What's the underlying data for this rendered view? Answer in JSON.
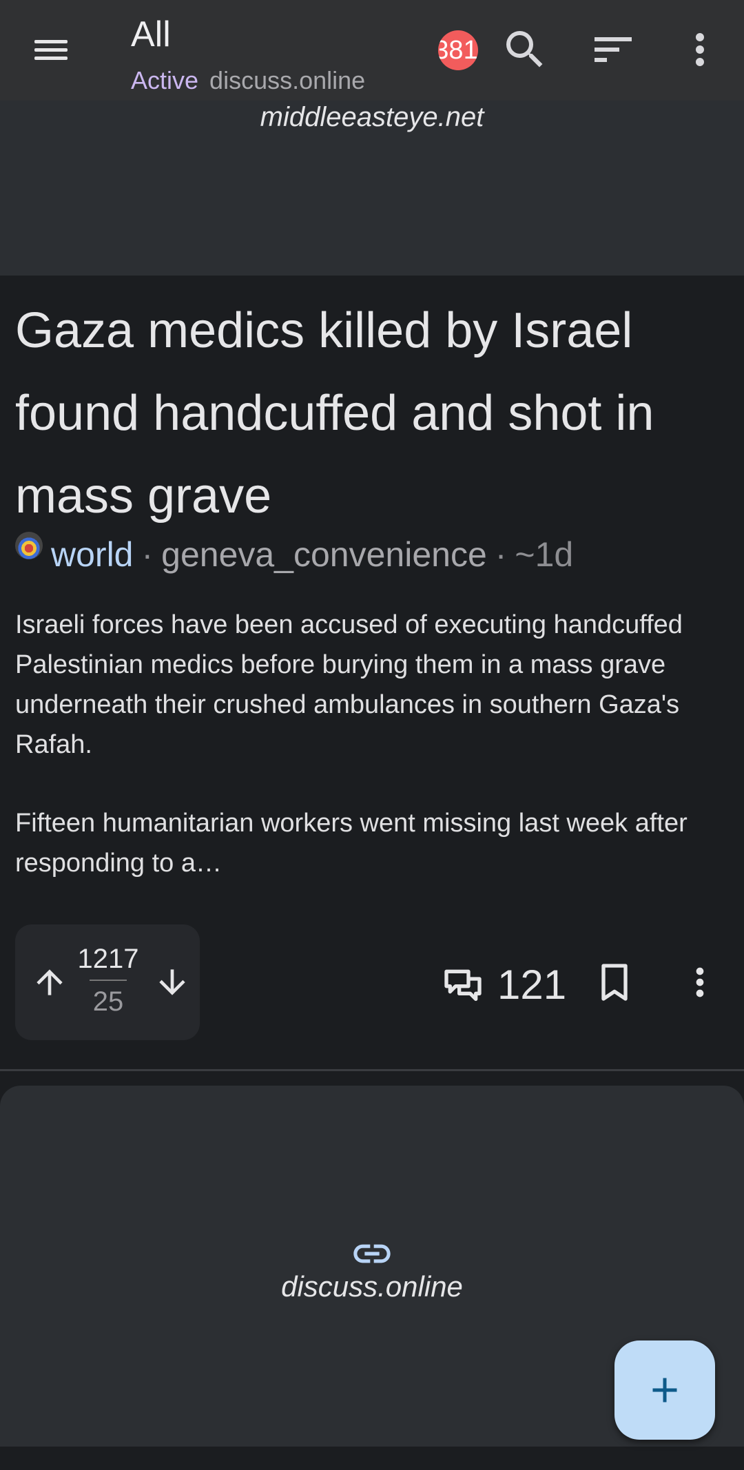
{
  "app_bar": {
    "title": "All",
    "listing_type": "Active",
    "instance": "discuss.online",
    "notification_count": "381",
    "icons": [
      "menu-icon",
      "search-icon",
      "sort-icon",
      "more-vert-icon"
    ]
  },
  "previous_post_preview": {
    "domain": "middleeasteye.net"
  },
  "post": {
    "title": "Gaza medics killed by Israel found handcuffed and shot in mass grave",
    "community": "world",
    "separator": "·",
    "author": "geneva_convenience",
    "age": "~1d",
    "body": [
      "Israeli forces have been accused of executing handcuffed Palestinian medics before burying them in a mass grave underneath their crushed ambulances in southern Gaza's Rafah.",
      "Fifteen humanitarian workers went missing last week after responding to a…"
    ],
    "upvotes": "1217",
    "downvotes": "25",
    "comment_count": "121"
  },
  "next_post_preview": {
    "domain": "discuss.online"
  },
  "colors": {
    "background": "#1b1d20",
    "card": "#2c2f33",
    "app_bar": "#303133",
    "community": "#b8d4f6",
    "active": "#cbb7f0",
    "badge": "#f25c5c",
    "fab": "#bfdcf7",
    "fab_icon": "#0e5a8a"
  }
}
